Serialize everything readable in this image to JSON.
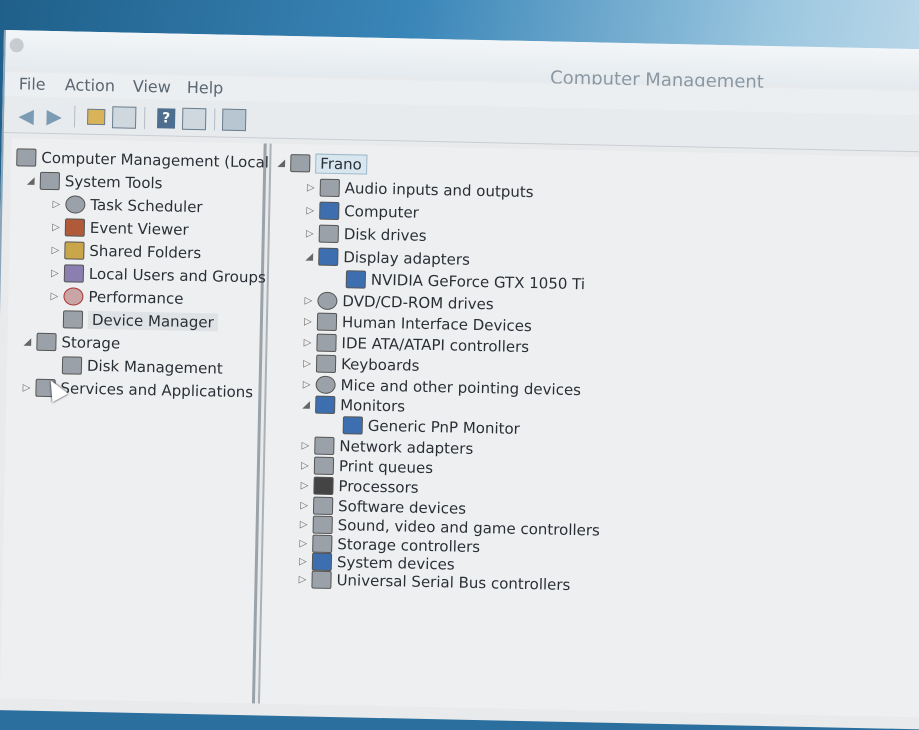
{
  "window": {
    "title": "Computer Management"
  },
  "menu": [
    "File",
    "Action",
    "View",
    "Help"
  ],
  "toolbar_icons": [
    "back-arrow-icon",
    "forward-arrow-icon",
    "up-folder-icon",
    "show-hide-console-tree-icon",
    "help-icon",
    "action-pane-icon",
    "properties-icon"
  ],
  "left_tree": {
    "root": "Computer Management (Local",
    "system_tools": "System Tools",
    "task_scheduler": "Task Scheduler",
    "event_viewer": "Event Viewer",
    "shared_folders": "Shared Folders",
    "local_users": "Local Users and Groups",
    "performance": "Performance",
    "device_manager": "Device Manager",
    "storage": "Storage",
    "disk_management": "Disk Management",
    "services": "Services and Applications"
  },
  "device_tree": {
    "computer_name": "Frano",
    "categories": [
      "Audio inputs and outputs",
      "Computer",
      "Disk drives",
      "Display adapters",
      "NVIDIA GeForce GTX 1050 Ti",
      "DVD/CD-ROM drives",
      "Human Interface Devices",
      "IDE ATA/ATAPI controllers",
      "Keyboards",
      "Mice and other pointing devices",
      "Monitors",
      "Generic PnP Monitor",
      "Network adapters",
      "Print queues",
      "Processors",
      "Software devices",
      "Sound, video and game controllers",
      "Storage controllers",
      "System devices",
      "Universal Serial Bus controllers"
    ]
  }
}
